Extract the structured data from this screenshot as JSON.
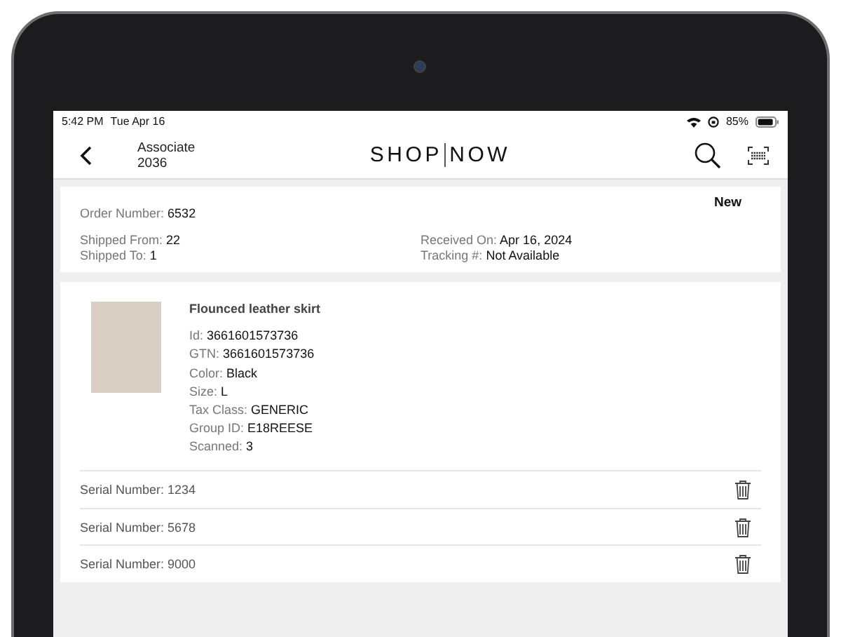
{
  "status_bar": {
    "time": "5:42 PM",
    "date": "Tue Apr 16",
    "battery": "85%"
  },
  "header": {
    "user_label": "Associate",
    "user_id": "2036",
    "logo_left": "SHOP",
    "logo_right": "NOW"
  },
  "order": {
    "status": "New",
    "number": {
      "label": "Order Number:",
      "value": "6532"
    },
    "rows": [
      {
        "left": {
          "label": "Shipped From:",
          "value": "22"
        },
        "right": {
          "label": "Received On:",
          "value": "Apr 16, 2024"
        }
      },
      {
        "left": {
          "label": "Shipped To:",
          "value": "1"
        },
        "right": {
          "label": "Tracking #:",
          "value": "Not Available"
        }
      }
    ]
  },
  "item": {
    "name": "Flounced leather skirt",
    "details": [
      {
        "label": "Id:",
        "value": "3661601573736"
      },
      {
        "label": "GTN:",
        "value": "3661601573736"
      },
      {
        "label": "Color:",
        "value": "Black"
      },
      {
        "label": "Size:",
        "value": "L"
      },
      {
        "label": "Tax Class:",
        "value": "GENERIC"
      },
      {
        "label": "Group ID:",
        "value": "E18REESE"
      },
      {
        "label": "Scanned:",
        "value": "3"
      }
    ],
    "serials": [
      "Serial Number: 1234",
      "Serial Number: 5678",
      "Serial Number: 9000"
    ]
  }
}
